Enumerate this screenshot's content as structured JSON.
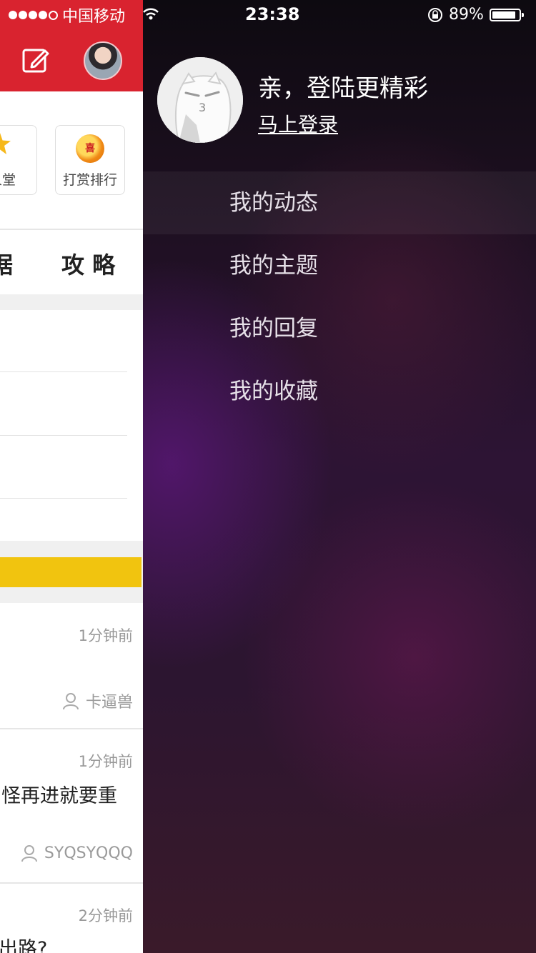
{
  "status_bar": {
    "carrier": "中国移动",
    "time": "23:38",
    "battery_percent": "89%",
    "battery_level": 0.89
  },
  "app_background": {
    "shortcuts": [
      {
        "label": "人堂",
        "icon": "star-medal-icon"
      },
      {
        "label": "打赏排行",
        "icon": "coin-icon"
      }
    ],
    "tab_partial": "据",
    "tab_label": "攻 略",
    "posts": [
      {
        "time": "1分钟前",
        "author": "卡逼兽",
        "title": ""
      },
      {
        "time": "1分钟前",
        "author": "SYQSYQQQ",
        "title": "怪再进就要重"
      },
      {
        "time": "2分钟前",
        "author": "",
        "title": "出路?"
      }
    ]
  },
  "drawer": {
    "greeting": "亲，登陆更精彩",
    "login_link": "马上登录",
    "menu": [
      {
        "label": "我的动态",
        "active": true
      },
      {
        "label": "我的主题",
        "active": false
      },
      {
        "label": "我的回复",
        "active": false
      },
      {
        "label": "我的收藏",
        "active": false
      }
    ]
  },
  "colors": {
    "brand_red": "#d9232f",
    "highlight_yellow": "#f1c40f",
    "drawer_dark": "#1c0f1f"
  }
}
